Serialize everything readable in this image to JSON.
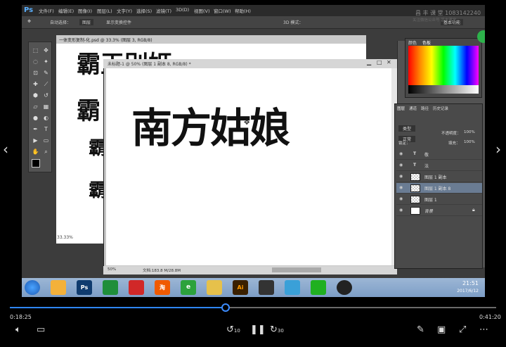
{
  "photoshop": {
    "logo": "Ps",
    "menu": [
      "文件(F)",
      "编辑(E)",
      "图像(I)",
      "图层(L)",
      "文字(Y)",
      "选择(S)",
      "滤镜(T)",
      "3D(D)",
      "视图(V)",
      "窗口(W)",
      "帮助(H)"
    ],
    "watermark": "昌 丰 课 堂   1083142240",
    "watermark_sub": "关注微信公众号  昌丰课堂",
    "options": {
      "auto_select": "自动选择：",
      "layer_select": "图层",
      "show_transform": "显示变换控件",
      "mode_3d": "3D 模式：",
      "workspace": "基本功能"
    },
    "doc_back_title": "一体变形复制-化.psd @ 33.3% (图层 3, RGB/8)",
    "doc_back_zoom": "33.33%",
    "doc_front_title": "未标题-1 @ 50% (图层 1 副本 8, RGB/8) *",
    "doc_front_text": "南方姑娘",
    "doc_front_zoom": "50%",
    "doc_front_status": "文档:183.8 M/28.8M",
    "back_text_1": "霸王别姬",
    "back_text_2": "霸",
    "panels": {
      "swatch_tabs": [
        "颜色",
        "色板"
      ],
      "layers_tabs": [
        "图层",
        "通道",
        "路径",
        "历史记录"
      ],
      "kind": "类型",
      "blend": "正常",
      "opacity_label": "不透明度：",
      "opacity": "100%",
      "fill_label": "填充：",
      "fill": "100%",
      "lock_label": "锁定："
    },
    "layers": [
      {
        "name": "敬",
        "type": "T"
      },
      {
        "name": "法",
        "type": "T"
      },
      {
        "name": "图层 1 副本",
        "type": "img"
      },
      {
        "name": "图层 1 副本 8",
        "type": "img",
        "selected": true
      },
      {
        "name": "图层 1",
        "type": "img"
      },
      {
        "name": "背景",
        "type": "bg"
      }
    ],
    "taskbar_time": "21:51",
    "taskbar_date": "2017/6/12"
  },
  "player": {
    "current_time": "0:18:25",
    "total_time": "0:41:20",
    "progress_fraction": 0.4456,
    "skip_back": "10",
    "skip_forward": "30"
  }
}
